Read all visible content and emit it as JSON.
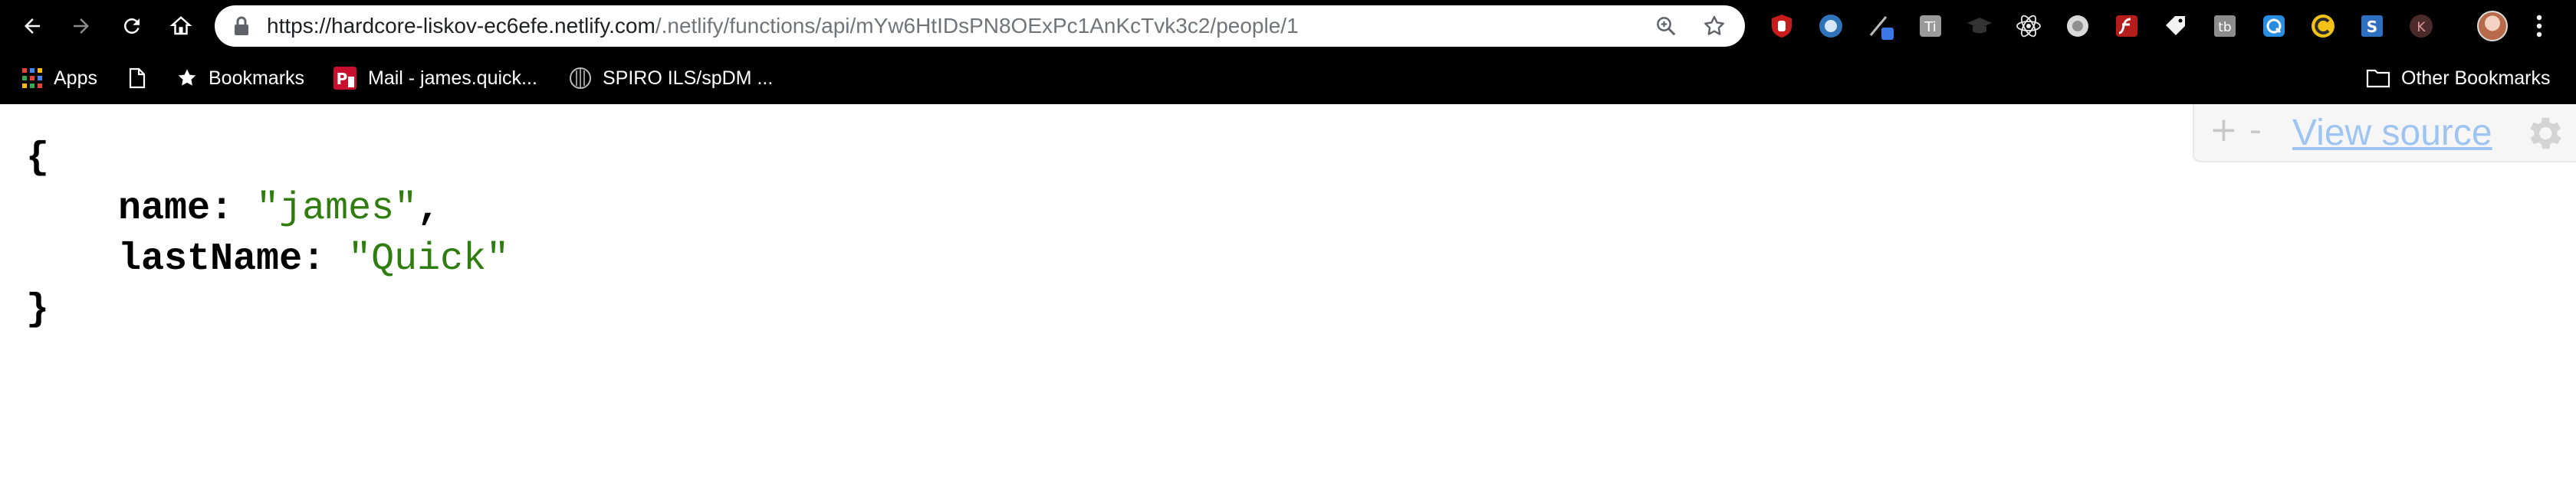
{
  "browser": {
    "url_host": "https://hardcore-liskov-ec6efe.netlify.com",
    "url_path": "/.netlify/functions/api/mYw6HtIDsPN8OExPc1AnKcTvk3c2/people/1",
    "nav_icons": [
      "back-icon",
      "forward-icon",
      "reload-icon",
      "home-icon"
    ],
    "omnibox_icons": [
      "lock-icon",
      "zoom-icon",
      "star-icon"
    ],
    "extensions": [
      "ublock-icon",
      "extension-circle-icon",
      "pen-extension-icon",
      "grammar-icon",
      "graduation-cap-icon",
      "react-devtools-icon",
      "circle-extension-icon",
      "flash-icon",
      "tag-icon",
      "tb-icon",
      "q-extension-icon",
      "c-extension-icon",
      "s-extension-icon",
      "k-extension-icon"
    ],
    "avatar": "profile-avatar",
    "menu": "more-menu-icon"
  },
  "bookmarks": {
    "apps_label": "Apps",
    "bookmarks_label": "Bookmarks",
    "mail_label": "Mail - james.quick...",
    "spiro_label": "SPIRO ILS/spDM ...",
    "other_label": "Other Bookmarks"
  },
  "json_view": {
    "open_brace": "{",
    "close_brace": "}",
    "fields": [
      {
        "key": "name",
        "value": "\"james\"",
        "trailing": ","
      },
      {
        "key": "lastName",
        "value": "\"Quick\"",
        "trailing": ""
      }
    ]
  },
  "viewer_tools": {
    "plus_label": "+",
    "minus_label": "-",
    "view_source_label": "View source"
  },
  "colors": {
    "string_value": "#2e7d0e",
    "toolbar_bg": "#000000",
    "link": "#9ec4f2"
  }
}
